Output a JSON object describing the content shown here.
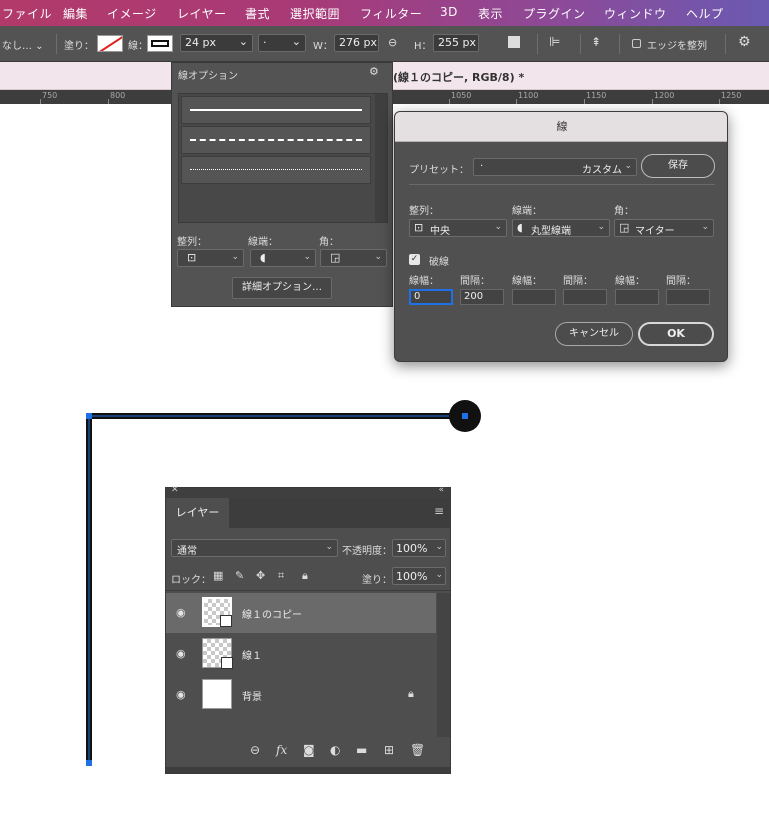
{
  "menubar": {
    "items": [
      "ファイル",
      "編集",
      "イメージ",
      "レイヤー",
      "書式",
      "選択範囲",
      "フィルター",
      "3D",
      "表示",
      "プラグイン",
      "ウィンドウ",
      "ヘルプ"
    ]
  },
  "options_bar": {
    "mode_label": "なし…",
    "fill_label": "塗り：",
    "stroke_label": "線：",
    "stroke_width": "24 px",
    "stroke_type": "·",
    "w_label": "W：",
    "w_value": "276 px",
    "h_label": "H：",
    "h_value": "255 px",
    "align_edges_label": "エッジを整列"
  },
  "doc_tab": {
    "title": "(線１のコピー, RGB/8) *"
  },
  "ruler": {
    "labels": [
      "750",
      "800",
      "1050",
      "1100",
      "1150",
      "1200",
      "1250"
    ]
  },
  "stroke_options_panel": {
    "title": "線オプション",
    "align_label": "整列：",
    "caps_label": "線端：",
    "corners_label": "角：",
    "more_options_button": "詳細オプション…"
  },
  "stroke_dialog": {
    "title": "線",
    "preset_label": "プリセット：",
    "preset_value": "カスタム",
    "preset_dot": "·",
    "save_button": "保存",
    "align_label": "整列：",
    "align_value": "中央",
    "caps_label": "線端：",
    "caps_value": "丸型線端",
    "corners_label": "角：",
    "corners_value": "マイター",
    "dashed_label": "破線",
    "dashed_checked": true,
    "dash_headers": [
      "線幅：",
      "間隔：",
      "線幅：",
      "間隔：",
      "線幅：",
      "間隔："
    ],
    "dash_values": [
      "0",
      "200",
      "",
      "",
      "",
      ""
    ],
    "cancel_button": "キャンセル",
    "ok_button": "OK"
  },
  "layers_panel": {
    "tab": "レイヤー",
    "blend_mode": "通常",
    "opacity_label": "不透明度：",
    "opacity_value": "100%",
    "lock_label": "ロック：",
    "fill_label": "塗り：",
    "fill_value": "100%",
    "layers": [
      {
        "name": "線１のコピー",
        "selected": true,
        "type": "shape"
      },
      {
        "name": "線１",
        "selected": false,
        "type": "shape"
      },
      {
        "name": "背景",
        "selected": false,
        "type": "background",
        "locked": true
      }
    ]
  },
  "colors": {
    "selection_blue": "#1f6fe5",
    "stroke_black": "#111111",
    "panel_gray": "#535353"
  }
}
